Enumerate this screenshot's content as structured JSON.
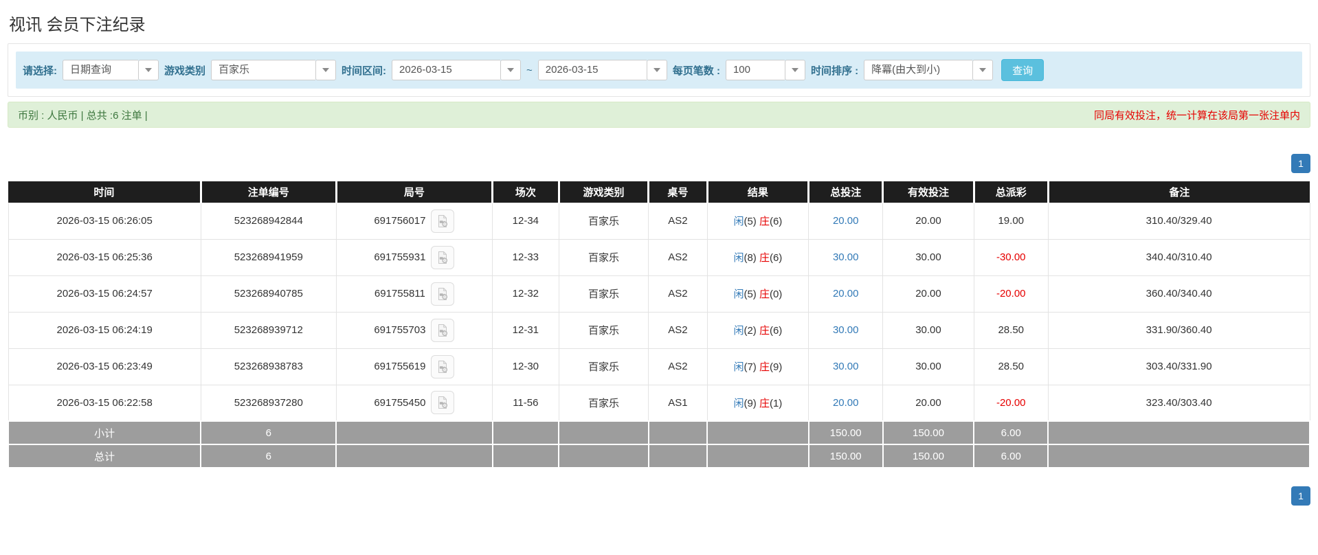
{
  "page": {
    "title": "视讯 会员下注纪录"
  },
  "filters": {
    "select_label": "请选择:",
    "select_value": "日期查询",
    "game_type_label": "游戏类别",
    "game_type_value": "百家乐",
    "time_range_label": "时间区间:",
    "date_from": "2026-03-15",
    "tilde": "~",
    "date_to": "2026-03-15",
    "page_size_label": "每页笔数 :",
    "page_size_value": "100",
    "sort_label": "时间排序 :",
    "sort_value": "降冪(由大到小)",
    "search_button": "查询"
  },
  "summary": {
    "left": "币别 : 人民币 | 总共 :6 注单 |",
    "right": "同局有效投注，统一计算在该局第一张注单内"
  },
  "pagination": {
    "page": "1"
  },
  "icons": {
    "combo_arrow": "chevron-down-icon",
    "round_video": "video-replay-icon"
  },
  "colors": {
    "blue": "#337ab7",
    "red": "#e60000",
    "header_bg": "#1e1e1e",
    "footer_bg": "#9d9d9d",
    "filter_bar_bg": "#d9edf7",
    "label_text": "#31708f",
    "search_btn_bg": "#5bc0de",
    "summary_bg": "#dff0d8",
    "summary_text": "#3c763d"
  },
  "table": {
    "headers": [
      "时间",
      "注单编号",
      "局号",
      "场次",
      "游戏类别",
      "桌号",
      "结果",
      "总投注",
      "有效投注",
      "总派彩",
      "备注"
    ],
    "col_widths": [
      "14.8%",
      "10.4%",
      "12.0%",
      "5.1%",
      "6.9%",
      "4.5%",
      "7.8%",
      "5.7%",
      "7.0%",
      "5.7%",
      "20.1%"
    ],
    "rows": [
      {
        "time": "2026-03-15 06:26:05",
        "bet_id": "523268942844",
        "round_id": "691756017",
        "session": "12-34",
        "game": "百家乐",
        "table_no": "AS2",
        "result": {
          "player_label": "闲",
          "player_score": "(5)",
          "banker_label": "庄",
          "banker_score": "(6)"
        },
        "total_bet": "20.00",
        "valid_bet": "20.00",
        "payout": "19.00",
        "note": "310.40/329.40"
      },
      {
        "time": "2026-03-15 06:25:36",
        "bet_id": "523268941959",
        "round_id": "691755931",
        "session": "12-33",
        "game": "百家乐",
        "table_no": "AS2",
        "result": {
          "player_label": "闲",
          "player_score": "(8)",
          "banker_label": "庄",
          "banker_score": "(6)"
        },
        "total_bet": "30.00",
        "valid_bet": "30.00",
        "payout": "-30.00",
        "note": "340.40/310.40"
      },
      {
        "time": "2026-03-15 06:24:57",
        "bet_id": "523268940785",
        "round_id": "691755811",
        "session": "12-32",
        "game": "百家乐",
        "table_no": "AS2",
        "result": {
          "player_label": "闲",
          "player_score": "(5)",
          "banker_label": "庄",
          "banker_score": "(0)"
        },
        "total_bet": "20.00",
        "valid_bet": "20.00",
        "payout": "-20.00",
        "note": "360.40/340.40"
      },
      {
        "time": "2026-03-15 06:24:19",
        "bet_id": "523268939712",
        "round_id": "691755703",
        "session": "12-31",
        "game": "百家乐",
        "table_no": "AS2",
        "result": {
          "player_label": "闲",
          "player_score": "(2)",
          "banker_label": "庄",
          "banker_score": "(6)"
        },
        "total_bet": "30.00",
        "valid_bet": "30.00",
        "payout": "28.50",
        "note": "331.90/360.40"
      },
      {
        "time": "2026-03-15 06:23:49",
        "bet_id": "523268938783",
        "round_id": "691755619",
        "session": "12-30",
        "game": "百家乐",
        "table_no": "AS2",
        "result": {
          "player_label": "闲",
          "player_score": "(7)",
          "banker_label": "庄",
          "banker_score": "(9)"
        },
        "total_bet": "30.00",
        "valid_bet": "30.00",
        "payout": "28.50",
        "note": "303.40/331.90"
      },
      {
        "time": "2026-03-15 06:22:58",
        "bet_id": "523268937280",
        "round_id": "691755450",
        "session": "11-56",
        "game": "百家乐",
        "table_no": "AS1",
        "result": {
          "player_label": "闲",
          "player_score": "(9)",
          "banker_label": "庄",
          "banker_score": "(1)"
        },
        "total_bet": "20.00",
        "valid_bet": "20.00",
        "payout": "-20.00",
        "note": "323.40/303.40"
      }
    ],
    "subtotal": {
      "label": "小计",
      "count": "6",
      "total_bet": "150.00",
      "valid_bet": "150.00",
      "payout": "6.00"
    },
    "total": {
      "label": "总计",
      "count": "6",
      "total_bet": "150.00",
      "valid_bet": "150.00",
      "payout": "6.00"
    }
  }
}
